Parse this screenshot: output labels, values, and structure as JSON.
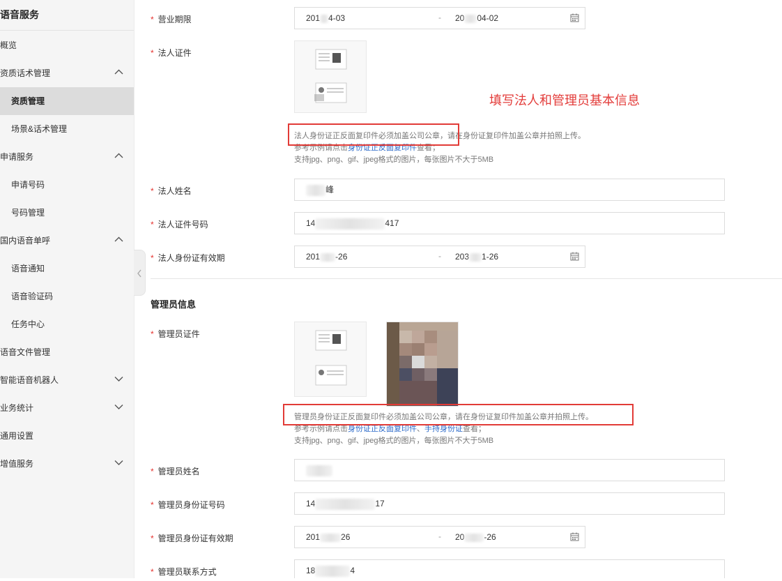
{
  "sidebar": {
    "title": "语音服务",
    "items": [
      {
        "label": "概览"
      },
      {
        "label": "资质话术管理"
      },
      {
        "label": "资质管理"
      },
      {
        "label": "场景&话术管理"
      },
      {
        "label": "申请服务"
      },
      {
        "label": "申请号码"
      },
      {
        "label": "号码管理"
      },
      {
        "label": "国内语音单呼"
      },
      {
        "label": "语音通知"
      },
      {
        "label": "语音验证码"
      },
      {
        "label": "任务中心"
      },
      {
        "label": "语音文件管理"
      },
      {
        "label": "智能语音机器人"
      },
      {
        "label": "业务统计"
      },
      {
        "label": "通用设置"
      },
      {
        "label": "增值服务"
      }
    ]
  },
  "form": {
    "business_term": {
      "label": "营业期限",
      "start_prefix": "201",
      "start_suffix": "4-03",
      "separator": "-",
      "end_prefix": "20",
      "end_suffix": "04-02"
    },
    "legal_cert": {
      "label": "法人证件"
    },
    "legal_hint_1": "法人身份证正反面复印件必须加盖公司公章，请在身份证复印件加盖公章并拍照上传。",
    "legal_hint_2_prefix": "参考示例请点击",
    "legal_hint_2_link": "身份证正反面复印件",
    "legal_hint_2_suffix": "查看；",
    "legal_hint_3": "支持jpg、png、gif、jpeg格式的图片，每张图片不大于5MB",
    "annotation": "填写法人和管理员基本信息",
    "legal_name": {
      "label": "法人姓名",
      "value_suffix": "峰"
    },
    "legal_id": {
      "label": "法人证件号码",
      "prefix": "14",
      "suffix": "417"
    },
    "legal_validity": {
      "label": "法人身份证有效期",
      "start_prefix": "201",
      "start_suffix": "-26",
      "separator": "-",
      "end_prefix": "203",
      "end_suffix": "1-26"
    },
    "admin_section_title": "管理员信息",
    "admin_cert": {
      "label": "管理员证件"
    },
    "admin_hint_1": "管理员身份证正反面复印件必须加盖公司公章，请在身份证复印件加盖公章并拍照上传。",
    "admin_hint_2_prefix": "参考示例请点击",
    "admin_hint_2_link1": "身份证正反面复印件",
    "admin_hint_2_sep": "、",
    "admin_hint_2_link2": "手持身份证",
    "admin_hint_2_suffix": "查看；",
    "admin_hint_3": "支持jpg、png、gif、jpeg格式的图片，每张图片不大于5MB",
    "admin_name": {
      "label": "管理员姓名"
    },
    "admin_id": {
      "label": "管理员身份证号码",
      "prefix": "14",
      "suffix": "17"
    },
    "admin_validity": {
      "label": "管理员身份证有效期",
      "start_prefix": "201",
      "start_suffix": "26",
      "separator": "-",
      "end_prefix": "20",
      "end_suffix": "-26"
    },
    "admin_contact": {
      "label": "管理员联系方式",
      "prefix": "18",
      "suffix": "4"
    }
  },
  "colors": {
    "required": "#e5322e",
    "annotation": "#e33c3a",
    "link": "#2a68c8",
    "sidebar_active": "#dcdcdc"
  }
}
